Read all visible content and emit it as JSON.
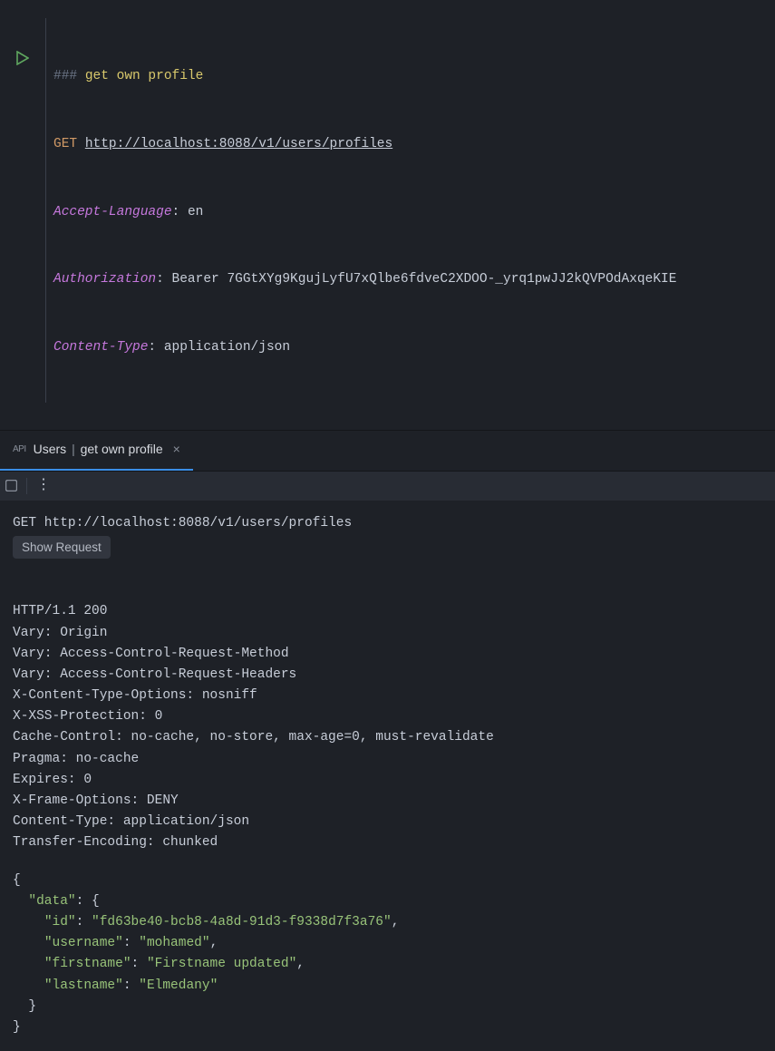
{
  "editor": {
    "heading_marker": "###",
    "heading_text": "get own profile",
    "method": "GET",
    "url": "http://localhost:8088/v1/users/profiles",
    "headers": [
      {
        "name": "Accept-Language",
        "value": "en"
      },
      {
        "name": "Authorization",
        "value": "Bearer 7GGtXYg9KgujLyfU7xQlbe6fdveC2XDOO-_yrq1pwJJ2kQVPOdAxqeKIE"
      },
      {
        "name": "Content-Type",
        "value": "application/json"
      }
    ]
  },
  "tab": {
    "icon_text": "API",
    "part1": "Users",
    "sep": "|",
    "part2": "get own profile",
    "close": "×"
  },
  "toolbar": {
    "more": "⋮"
  },
  "response": {
    "request_line": "GET http://localhost:8088/v1/users/profiles",
    "show_request_label": "Show Request",
    "status_line": "HTTP/1.1 200",
    "headers": [
      "Vary: Origin",
      "Vary: Access-Control-Request-Method",
      "Vary: Access-Control-Request-Headers",
      "X-Content-Type-Options: nosniff",
      "X-XSS-Protection: 0",
      "Cache-Control: no-cache, no-store, max-age=0, must-revalidate",
      "Pragma: no-cache",
      "Expires: 0",
      "X-Frame-Options: DENY",
      "Content-Type: application/json",
      "Transfer-Encoding: chunked"
    ],
    "body": {
      "data": {
        "id": "fd63be40-bcb8-4a8d-91d3-f9338d7f3a76",
        "username": "mohamed",
        "firstname": "Firstname updated",
        "lastname": "Elmedany"
      }
    }
  }
}
